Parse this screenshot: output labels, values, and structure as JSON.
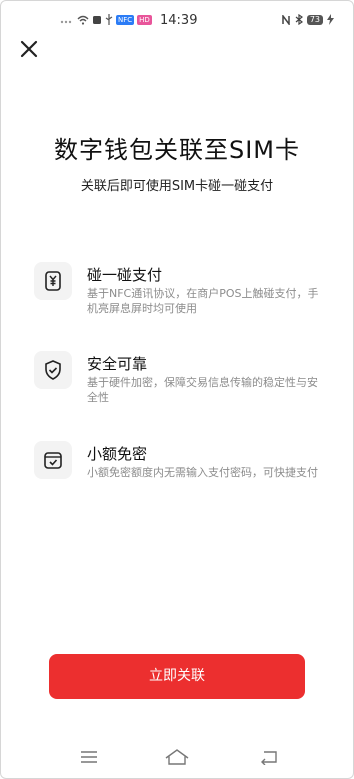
{
  "status_bar": {
    "time": "14:39",
    "badge_blue": "NFC",
    "badge_pink": "HD",
    "battery": "73"
  },
  "header": {
    "close_icon": "close-icon"
  },
  "main": {
    "title": "数字钱包关联至SIM卡",
    "subtitle": "关联后即可使用SIM卡碰一碰支付"
  },
  "features": [
    {
      "icon": "tap-pay-icon",
      "title": "碰一碰支付",
      "description": "基于NFC通讯协议，在商户POS上触碰支付，手机亮屏息屏时均可使用"
    },
    {
      "icon": "shield-check-icon",
      "title": "安全可靠",
      "description": "基于硬件加密，保障交易信息传输的稳定性与安全性"
    },
    {
      "icon": "wallet-check-icon",
      "title": "小额免密",
      "description": "小额免密额度内无需输入支付密码，可快捷支付"
    }
  ],
  "cta": {
    "label": "立即关联"
  },
  "navbar": {
    "menu_icon": "menu-icon",
    "home_icon": "home-icon",
    "back_icon": "back-icon"
  },
  "colors": {
    "accent": "#ec2f2f",
    "muted_text": "#8c8c8c",
    "icon_bg": "#f3f3f3"
  }
}
